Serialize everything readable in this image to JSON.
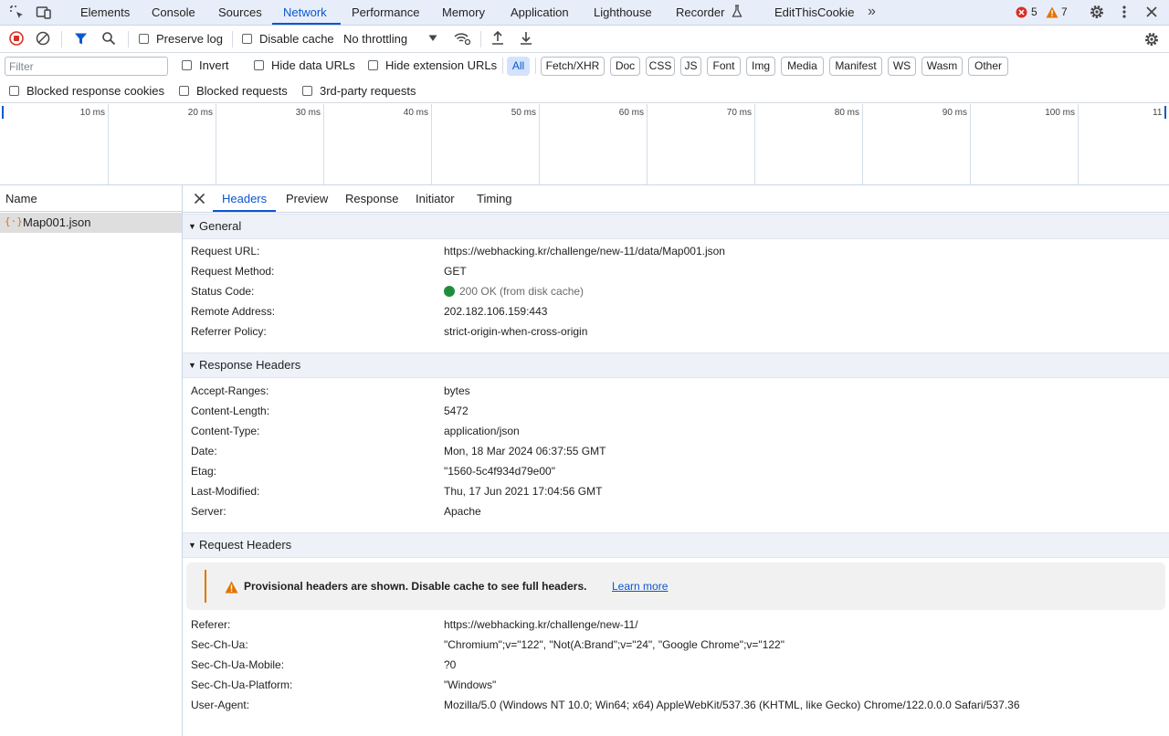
{
  "devtools": {
    "tabs": [
      "Elements",
      "Console",
      "Sources",
      "Network",
      "Performance",
      "Memory",
      "Application",
      "Lighthouse",
      "Recorder",
      "EditThisCookie"
    ],
    "active_tab": "Network",
    "error_count": "5",
    "warning_count": "7"
  },
  "toolbar": {
    "preserve_log": "Preserve log",
    "disable_cache": "Disable cache",
    "throttling": "No throttling"
  },
  "filter": {
    "placeholder": "Filter",
    "invert": "Invert",
    "hide_data_urls": "Hide data URLs",
    "hide_extension_urls": "Hide extension URLs",
    "types": [
      "All",
      "Fetch/XHR",
      "Doc",
      "CSS",
      "JS",
      "Font",
      "Img",
      "Media",
      "Manifest",
      "WS",
      "Wasm",
      "Other"
    ],
    "active_type": "All",
    "blocked_response_cookies": "Blocked response cookies",
    "blocked_requests": "Blocked requests",
    "third_party_requests": "3rd-party requests"
  },
  "timeline": {
    "ticks": [
      "10 ms",
      "20 ms",
      "30 ms",
      "40 ms",
      "50 ms",
      "60 ms",
      "70 ms",
      "80 ms",
      "90 ms",
      "100 ms",
      "11"
    ]
  },
  "requests": {
    "column_name": "Name",
    "items": [
      {
        "name": "Map001.json",
        "icon": "json-braces-icon"
      }
    ]
  },
  "details": {
    "tabs": [
      "Headers",
      "Preview",
      "Response",
      "Initiator",
      "Timing"
    ],
    "active_tab": "Headers",
    "general": {
      "title": "General",
      "rows": [
        {
          "key": "Request URL:",
          "value": "https://webhacking.kr/challenge/new-11/data/Map001.json"
        },
        {
          "key": "Request Method:",
          "value": "GET"
        },
        {
          "key": "Status Code:",
          "value": "200 OK (from disk cache)"
        },
        {
          "key": "Remote Address:",
          "value": "202.182.106.159:443"
        },
        {
          "key": "Referrer Policy:",
          "value": "strict-origin-when-cross-origin"
        }
      ]
    },
    "response_headers": {
      "title": "Response Headers",
      "rows": [
        {
          "key": "Accept-Ranges:",
          "value": "bytes"
        },
        {
          "key": "Content-Length:",
          "value": "5472"
        },
        {
          "key": "Content-Type:",
          "value": "application/json"
        },
        {
          "key": "Date:",
          "value": "Mon, 18 Mar 2024 06:37:55 GMT"
        },
        {
          "key": "Etag:",
          "value": "\"1560-5c4f934d79e00\""
        },
        {
          "key": "Last-Modified:",
          "value": "Thu, 17 Jun 2021 17:04:56 GMT"
        },
        {
          "key": "Server:",
          "value": "Apache"
        }
      ]
    },
    "request_headers": {
      "title": "Request Headers",
      "warning": "Provisional headers are shown. Disable cache to see full headers.",
      "learn_more": "Learn more",
      "rows": [
        {
          "key": "Referer:",
          "value": "https://webhacking.kr/challenge/new-11/"
        },
        {
          "key": "Sec-Ch-Ua:",
          "value": "\"Chromium\";v=\"122\", \"Not(A:Brand\";v=\"24\", \"Google Chrome\";v=\"122\""
        },
        {
          "key": "Sec-Ch-Ua-Mobile:",
          "value": "?0"
        },
        {
          "key": "Sec-Ch-Ua-Platform:",
          "value": "\"Windows\""
        },
        {
          "key": "User-Agent:",
          "value": "Mozilla/5.0 (Windows NT 10.0; Win64; x64) AppleWebKit/537.36 (KHTML, like Gecko) Chrome/122.0.0.0 Safari/537.36"
        }
      ]
    }
  },
  "colors": {
    "accent": "#0b57d0",
    "status_ok": "#1e8e3e",
    "error": "#d93025",
    "warning": "#e37400"
  }
}
